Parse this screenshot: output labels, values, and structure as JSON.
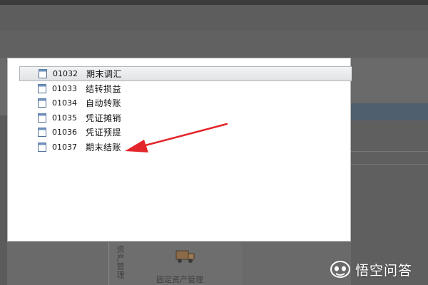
{
  "list": {
    "items": [
      {
        "code": "01032",
        "label": "期末调汇",
        "selected": true
      },
      {
        "code": "01033",
        "label": "结转损益",
        "selected": false
      },
      {
        "code": "01034",
        "label": "自动转账",
        "selected": false
      },
      {
        "code": "01035",
        "label": "凭证摊销",
        "selected": false
      },
      {
        "code": "01036",
        "label": "凭证预提",
        "selected": false
      },
      {
        "code": "01037",
        "label": "期末结账",
        "selected": false
      }
    ]
  },
  "background_widget": {
    "vertical_label": "资产管理",
    "label": "固定资产管理"
  },
  "watermark": {
    "text": "悟空问答"
  },
  "colors": {
    "arrow": "#e2262b",
    "selected_bg": "#e8eaec",
    "dimmed_bg": "#6a6a6a"
  },
  "icons": {
    "item_icon": "document-icon",
    "background_icon": "truck-icon",
    "watermark_icon": "wukong-logo-icon"
  }
}
